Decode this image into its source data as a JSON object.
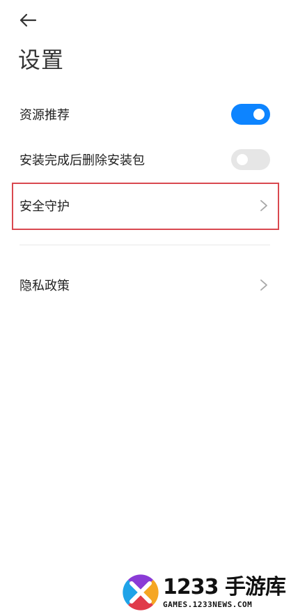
{
  "header": {
    "title": "设置",
    "back_icon": "arrow-left-icon"
  },
  "settings": {
    "resource_recommend": {
      "label": "资源推荐",
      "enabled": true
    },
    "delete_package": {
      "label": "安装完成后删除安装包",
      "enabled": false
    },
    "security": {
      "label": "安全守护",
      "icon": "chevron-right-icon",
      "highlighted": true
    },
    "privacy": {
      "label": "隐私政策",
      "icon": "chevron-right-icon"
    }
  },
  "watermark": {
    "brand": "1233 手游库",
    "url": "GAMES.1233NEWS.COM"
  },
  "colors": {
    "accent": "#0d84ff",
    "toggle_off": "#e6e6e6",
    "highlight": "#d9484f"
  }
}
